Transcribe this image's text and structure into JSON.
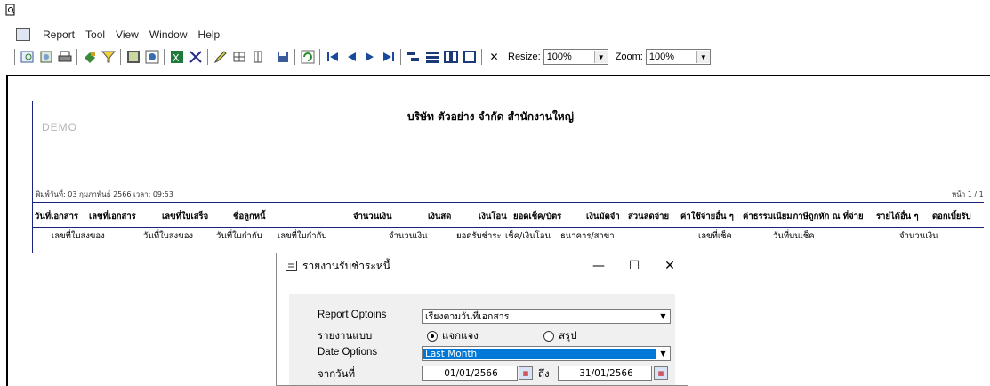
{
  "menu": [
    "Report",
    "Tool",
    "View",
    "Window",
    "Help"
  ],
  "toolbar": {
    "resize_label": "Resize:",
    "resize_value": "100%",
    "zoom_label": "Zoom:",
    "zoom_value": "100%",
    "close_glyph": "✕"
  },
  "report": {
    "watermark": "DEMO",
    "company": "บริษัท ตัวอย่าง จำกัด   สำนักงานใหญ่",
    "printed": "พิมพ์วันที่: 03 กุมภาพันธ์ 2566  เวลา: 09:53",
    "page": "หน้า 1 / 1",
    "header_row1": [
      "วันที่เอกสาร",
      "เลขที่เอกสาร",
      "เลขที่ใบเสร็จ",
      "ชื่อลูกหนี้",
      "จำนวนเงิน",
      "เงินสด",
      "เงินโอน",
      "ยอดเช็ค/บัตร",
      "เงินมัดจำ",
      "ส่วนลดจ่าย",
      "ค่าใช้จ่ายอื่น ๆ",
      "ค่าธรรมเนียม",
      "ภาษีถูกหัก ณ ที่จ่าย",
      "รายได้อื่น ๆ",
      "ดอกเบี้ยรับ"
    ],
    "header_row2": [
      "เลขที่ใบส่งของ",
      "วันที่ใบส่งของ",
      "วันที่ใบกำกับ",
      "เลขที่ใบกำกับ",
      "จำนวนเงิน",
      "ยอดรับชำระ",
      "เช็ค/เงินโอน",
      "ธนาคาร/สาขา",
      "เลขที่เช็ค",
      "วันที่บนเช็ค",
      "จำนวนเงิน"
    ]
  },
  "dialog": {
    "title": "รายงานรับชำระหนี้",
    "report_options_label": "Report Optoins",
    "report_options_value": "เรียงตามวันที่เอกสาร",
    "report_type_label": "รายงานแบบ",
    "radio_detail": "แจกแจง",
    "radio_summary": "สรุป",
    "date_options_label": "Date Options",
    "date_options_value": "Last Month",
    "from_date_label": "จากวันที่",
    "from_date": "01/01/2566",
    "to_label": "ถึง",
    "to_date": "31/01/2566"
  }
}
